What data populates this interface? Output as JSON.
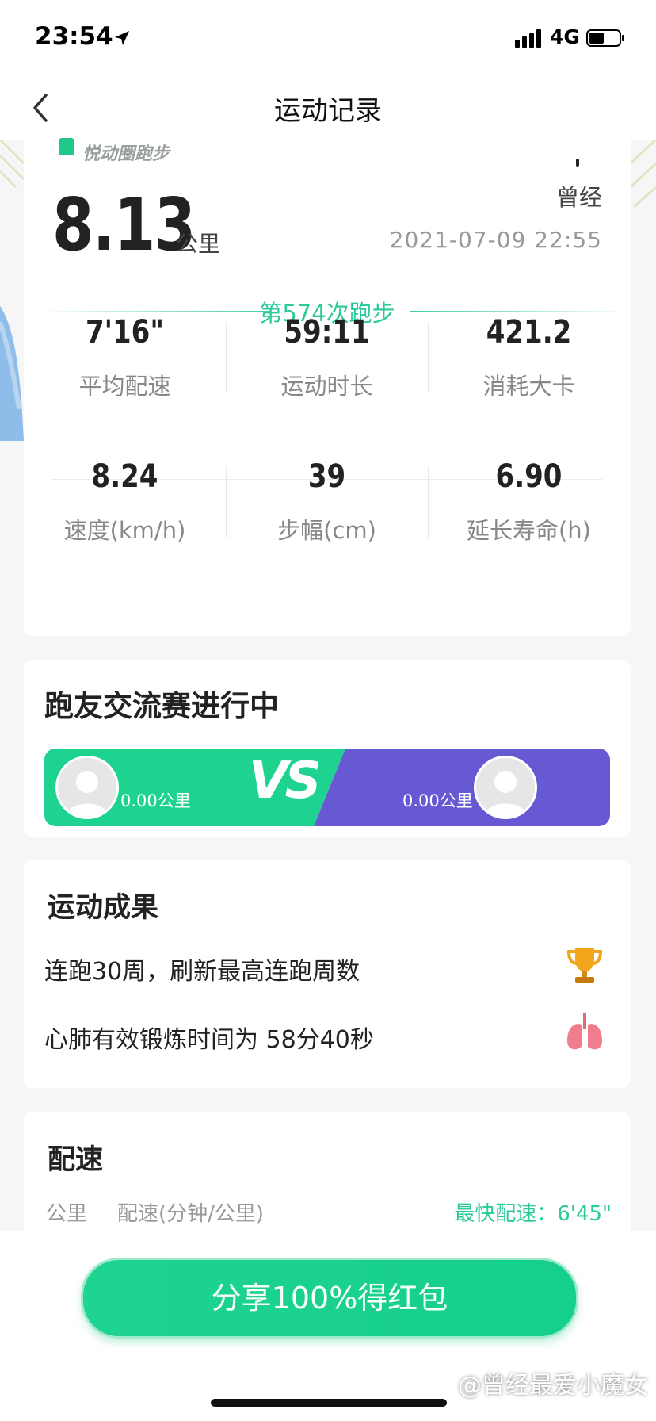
{
  "status": {
    "time": "23:54",
    "network": "4G"
  },
  "nav": {
    "title": "运动记录"
  },
  "summary": {
    "brand": "悦动圈跑步",
    "distance": "8.13",
    "distance_unit": "公里",
    "username": "曾经",
    "datetime": "2021-07-09 22:55",
    "run_count": "第574次跑步",
    "stats": [
      {
        "value": "7'16\"",
        "label": "平均配速"
      },
      {
        "value": "59:11",
        "label": "运动时长"
      },
      {
        "value": "421.2",
        "label": "消耗大卡"
      },
      {
        "value": "8.24",
        "label": "速度(km/h)"
      },
      {
        "value": "39",
        "label": "步幅(cm)"
      },
      {
        "value": "6.90",
        "label": "延长寿命(h)"
      }
    ]
  },
  "match": {
    "title": "跑友交流赛进行中",
    "left_km": "0.00公里",
    "right_km": "0.00公里",
    "vs": "VS",
    "left_color": "#1ed390",
    "right_color": "#6759d3"
  },
  "achievements": {
    "title": "运动成果",
    "items": [
      {
        "text": "连跑30周，刷新最高连跑周数",
        "icon": "trophy-icon"
      },
      {
        "text": "心肺有效锻炼时间为 58分40秒",
        "icon": "lungs-icon"
      }
    ]
  },
  "pace": {
    "title": "配速",
    "col_km": "公里",
    "col_pace": "配速(分钟/公里)",
    "fastest": "最快配速：6'45\""
  },
  "share_button": "分享100%得红包",
  "watermark": "@曾经最爱小魔女",
  "accent_color": "#2cc99a"
}
